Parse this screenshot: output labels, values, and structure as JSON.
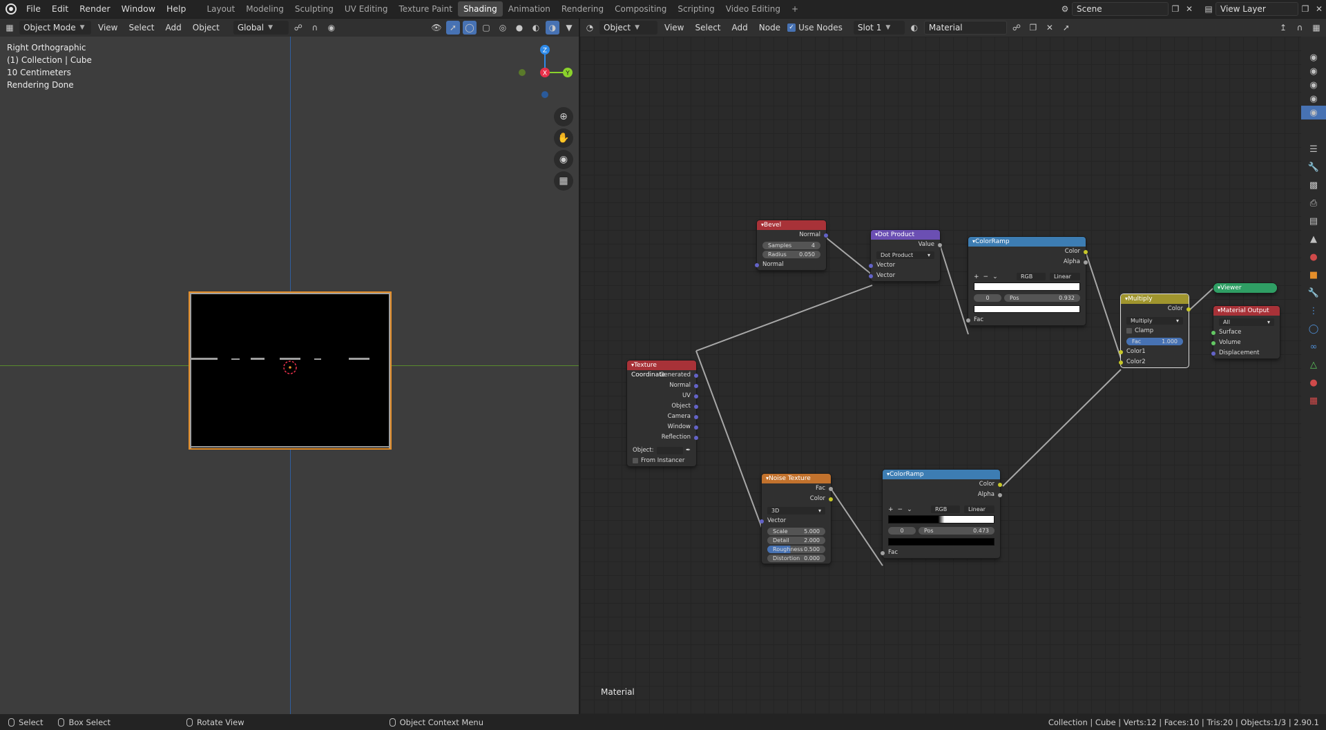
{
  "menu": {
    "items": [
      "File",
      "Edit",
      "Render",
      "Window",
      "Help"
    ]
  },
  "workspaces": {
    "tabs": [
      "Layout",
      "Modeling",
      "Sculpting",
      "UV Editing",
      "Texture Paint",
      "Shading",
      "Animation",
      "Rendering",
      "Compositing",
      "Scripting",
      "Video Editing"
    ],
    "active": "Shading",
    "add": "+"
  },
  "scene": {
    "name": "Scene",
    "view_layer": "View Layer"
  },
  "viewport": {
    "header": {
      "mode": "Object Mode",
      "view": "View",
      "select": "Select",
      "add": "Add",
      "object": "Object",
      "orientation": "Global"
    },
    "info": {
      "view": "Right Orthographic",
      "collection": "(1) Collection | Cube",
      "scale": "10 Centimeters",
      "status": "Rendering Done"
    },
    "gizmo": {
      "x": "X",
      "y": "Y",
      "z": "Z"
    }
  },
  "node_editor": {
    "header": {
      "type": "Object",
      "view": "View",
      "select": "Select",
      "add": "Add",
      "node": "Node",
      "use_nodes": "Use Nodes",
      "slot": "Slot 1",
      "material": "Material"
    },
    "footer_label": "Material",
    "nodes": {
      "bevel": {
        "title": "Bevel",
        "out_normal": "Normal",
        "samples_label": "Samples",
        "samples": "4",
        "radius_label": "Radius",
        "radius": "0.050",
        "in_normal": "Normal"
      },
      "dot": {
        "title": "Dot Product",
        "out_value": "Value",
        "op": "Dot Product",
        "in1": "Vector",
        "in2": "Vector"
      },
      "ramp1": {
        "title": "ColorRamp",
        "out_color": "Color",
        "out_alpha": "Alpha",
        "mode": "RGB",
        "interp": "Linear",
        "index": "0",
        "pos_label": "Pos",
        "pos": "0.932",
        "in_fac": "Fac",
        "add": "+",
        "remove": "−"
      },
      "texcoord": {
        "title": "Texture Coordinate",
        "outputs": [
          "Generated",
          "Normal",
          "UV",
          "Object",
          "Camera",
          "Window",
          "Reflection"
        ],
        "object_label": "Object:",
        "from_instancer": "From Instancer"
      },
      "noise": {
        "title": "Noise Texture",
        "out_fac": "Fac",
        "out_color": "Color",
        "dims": "3D",
        "in_vector": "Vector",
        "scale_label": "Scale",
        "scale": "5.000",
        "detail_label": "Detail",
        "detail": "2.000",
        "rough_label": "Roughness",
        "rough": "0.500",
        "dist_label": "Distortion",
        "dist": "0.000"
      },
      "ramp2": {
        "title": "ColorRamp",
        "out_color": "Color",
        "out_alpha": "Alpha",
        "mode": "RGB",
        "interp": "Linear",
        "index": "0",
        "pos_label": "Pos",
        "pos": "0.473",
        "in_fac": "Fac",
        "add": "+",
        "remove": "−"
      },
      "multiply": {
        "title": "Multiply",
        "out_color": "Color",
        "op": "Multiply",
        "clamp": "Clamp",
        "fac_label": "Fac",
        "fac": "1.000",
        "in1": "Color1",
        "in2": "Color2"
      },
      "viewer": {
        "title": "Viewer"
      },
      "output": {
        "title": "Material Output",
        "target": "All",
        "in_surface": "Surface",
        "in_volume": "Volume",
        "in_disp": "Displacement"
      }
    }
  },
  "status": {
    "select": "Select",
    "box_select": "Box Select",
    "rotate": "Rotate View",
    "context": "Object Context Menu",
    "stats": "Collection | Cube | Verts:12 | Faces:10 | Tris:20 | Objects:1/3 | 2.90.1"
  },
  "colors": {
    "accent": "#4772b3",
    "selection": "#e58f2a",
    "x_axis": "#e8304a",
    "y_axis": "#8bd22c",
    "z_axis": "#2e8ae8"
  }
}
